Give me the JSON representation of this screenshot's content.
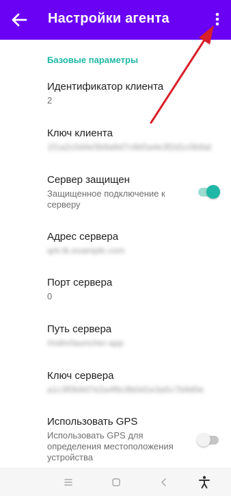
{
  "appbar": {
    "title": "Настройки агента",
    "back_icon": "arrow-left-icon",
    "more_icon": "more-vert-icon",
    "color": "#6a00f4"
  },
  "section": {
    "header": "Базовые параметры",
    "accent": "#1fb8a6"
  },
  "prefs": {
    "client_id": {
      "title": "Идентификатор клиента",
      "value": "2"
    },
    "client_key": {
      "title": "Ключ клиента",
      "value": "1f1a2c0d4e5b9a8d7c6b5a4e3f2d1c0b9a8e7d6c"
    },
    "secure": {
      "title": "Сервер защищен",
      "summary": "Защищенное подключение к серверу",
      "enabled": true
    },
    "server_address": {
      "title": "Адрес сервера",
      "value": "qrtr.tk.example.com"
    },
    "server_port": {
      "title": "Порт сервера",
      "value": "0"
    },
    "server_path": {
      "title": "Путь сервера",
      "value": "/mdm/launcher-app"
    },
    "server_key": {
      "title": "Ключ сервера",
      "value": "a1c3f0b9d7e2a4f6c8b0d1e3a5c7b9d0e2f4a6c8"
    },
    "gps": {
      "title": "Использовать GPS",
      "summary": "Использовать GPS для определения местоположения устройства",
      "enabled": false
    }
  },
  "annotation": {
    "color": "#d81f2a"
  },
  "navbar": {
    "icons": [
      "menu-icon",
      "home-icon",
      "back-icon",
      "accessibility-icon"
    ]
  }
}
